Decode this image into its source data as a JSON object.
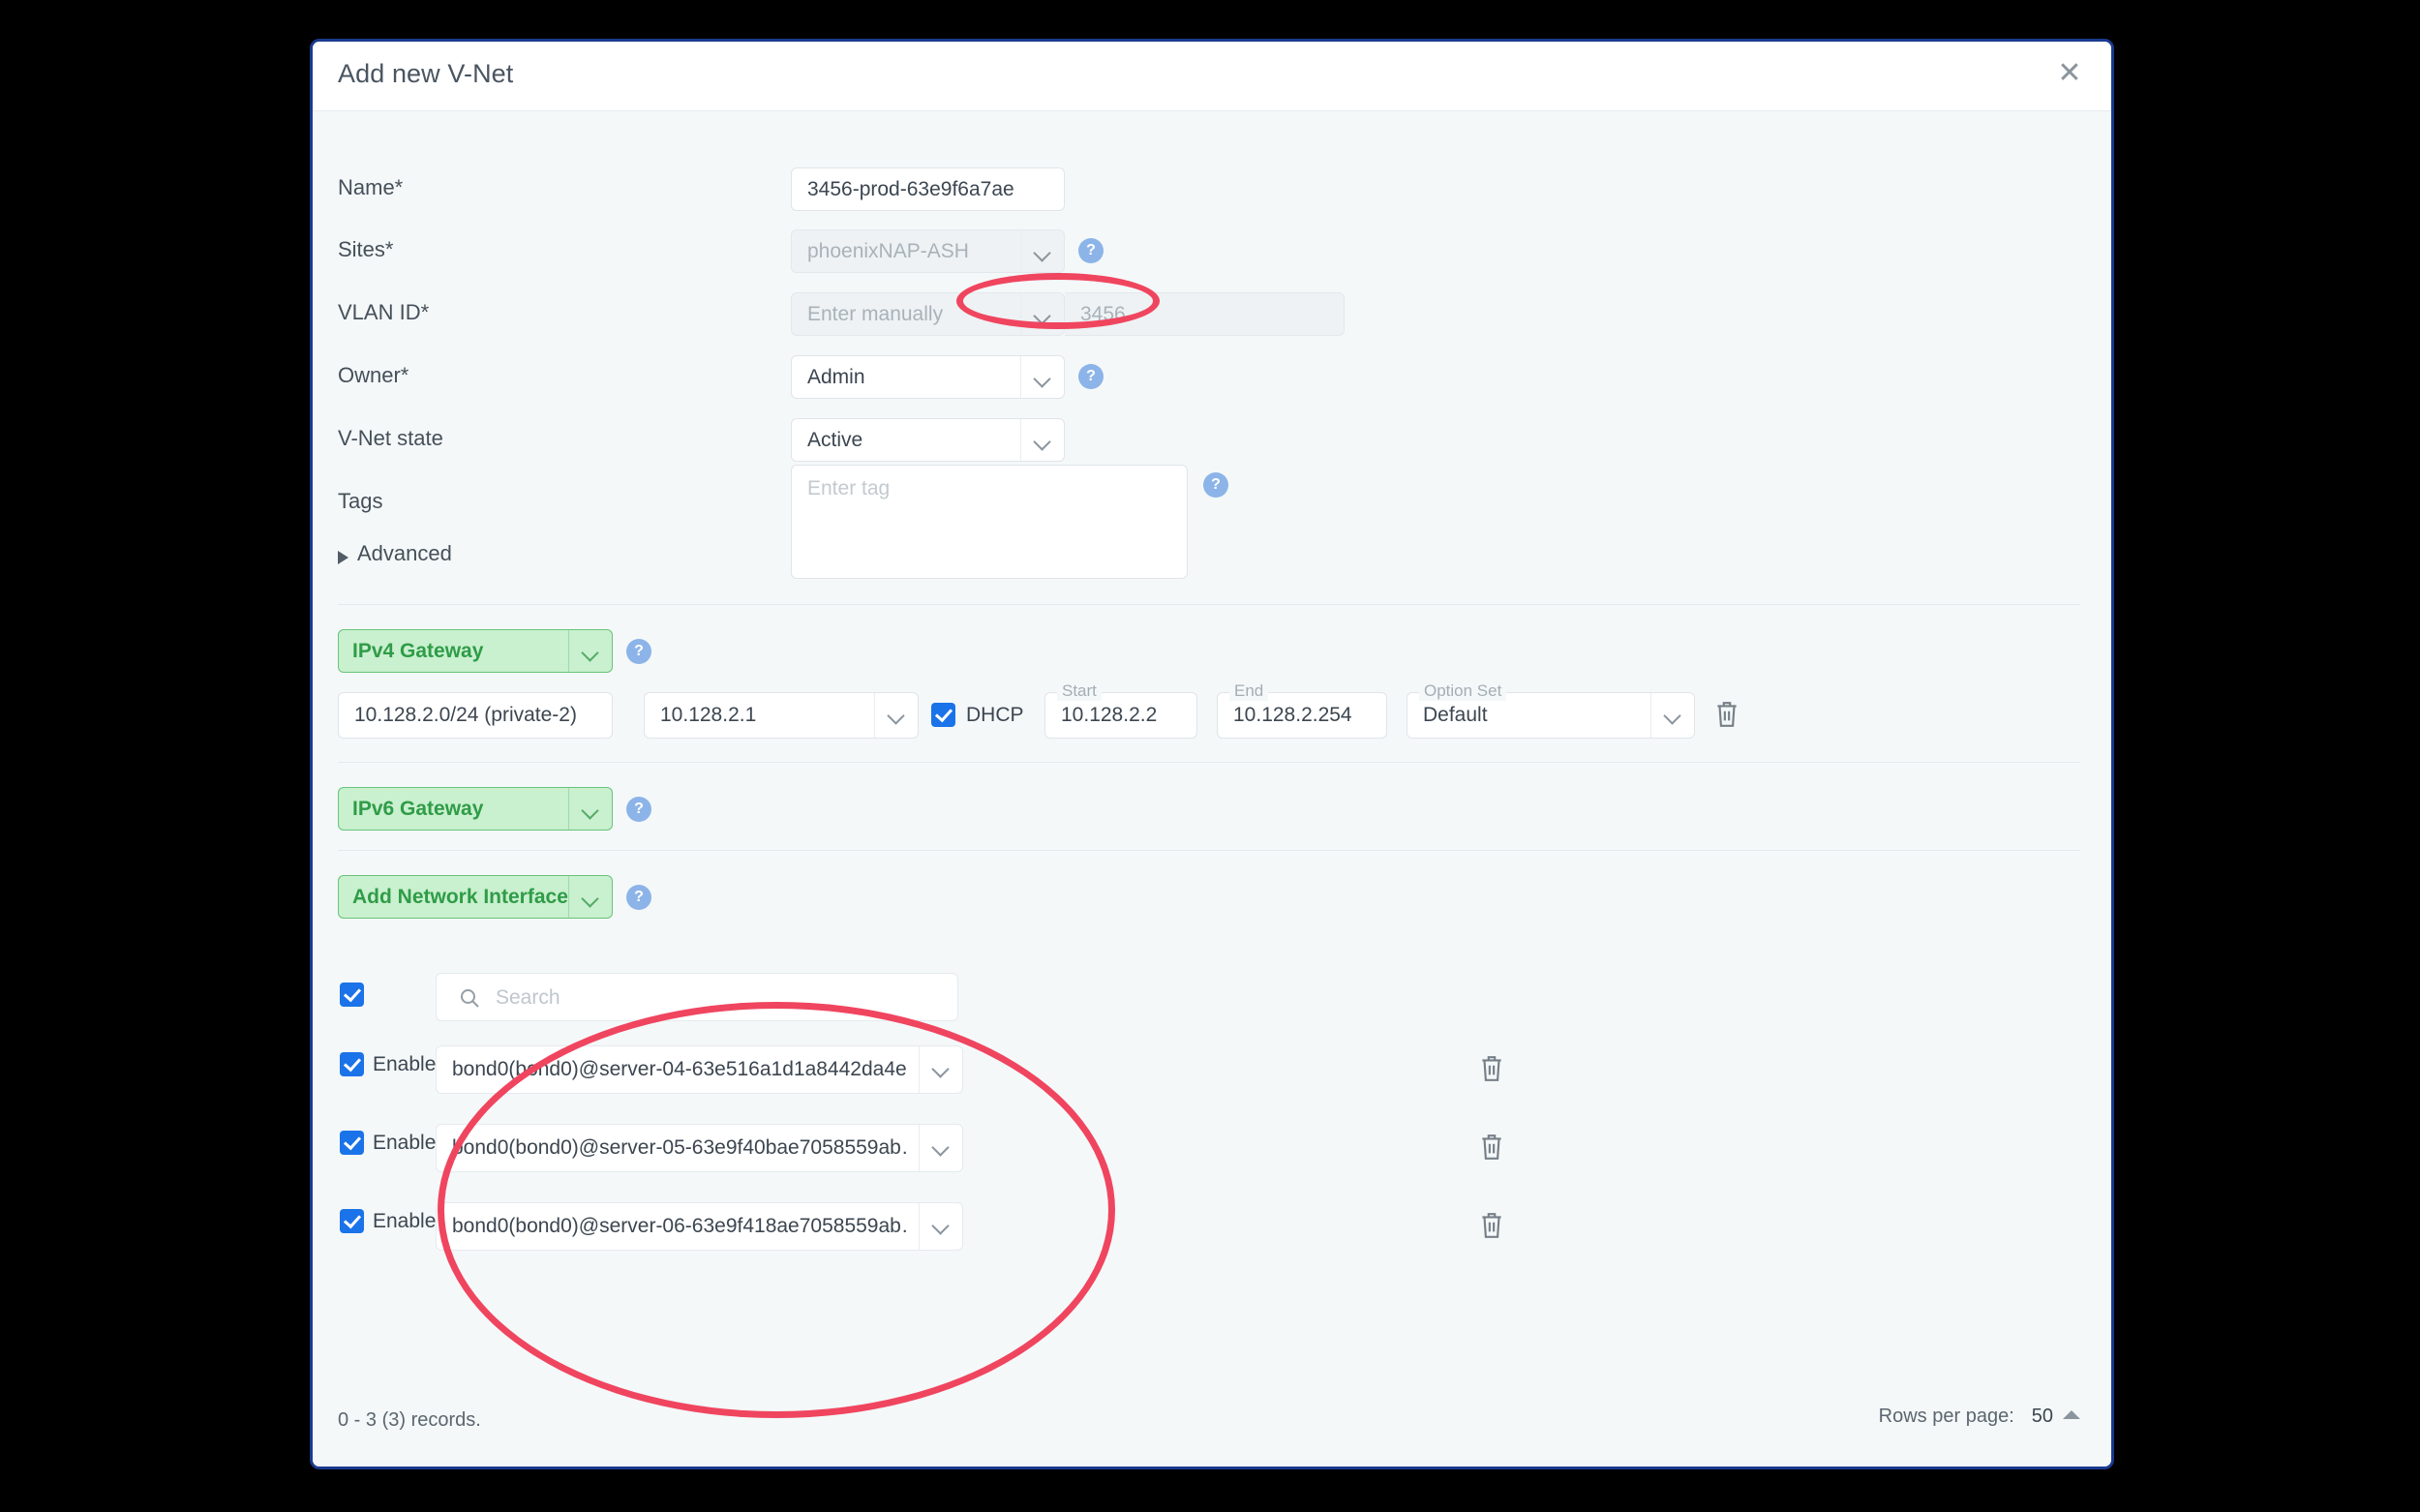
{
  "dialog": {
    "title": "Add new V-Net",
    "close_icon": "close-icon"
  },
  "form": {
    "name": {
      "label": "Name*",
      "value": "3456-prod-63e9f6a7ae"
    },
    "sites": {
      "label": "Sites*",
      "value": "phoenixNAP-ASH",
      "help": "?"
    },
    "vlan_id": {
      "label": "VLAN ID*",
      "mode_value": "Enter manually",
      "id_value": "3456"
    },
    "owner": {
      "label": "Owner*",
      "value": "Admin",
      "help": "?"
    },
    "vnet_state": {
      "label": "V-Net state",
      "value": "Active"
    },
    "tags": {
      "label": "Tags",
      "placeholder": "Enter tag",
      "help": "?"
    },
    "advanced": {
      "label": "Advanced"
    }
  },
  "gateways": {
    "ipv4": {
      "selector_label": "IPv4 Gateway",
      "help": "?",
      "network": "10.128.2.0/24 (private-2)",
      "gateway_ip": "10.128.2.1",
      "dhcp_label": "DHCP",
      "start": {
        "label": "Start",
        "value": "10.128.2.2"
      },
      "end": {
        "label": "End",
        "value": "10.128.2.254"
      },
      "option_set": {
        "label": "Option Set",
        "value": "Default"
      },
      "delete_icon": "trash-icon"
    },
    "ipv6": {
      "selector_label": "IPv6 Gateway",
      "help": "?"
    }
  },
  "network_interfaces": {
    "add_label": "Add Network Interface",
    "add_help": "?",
    "search_placeholder": "Search",
    "search_icon": "search-icon",
    "select_all_checked": true,
    "rows": [
      {
        "enabled_label": "Enabled",
        "checked": true,
        "value": "bond0(bond0)@server-04-63e516a1d1a8442da4e…"
      },
      {
        "enabled_label": "Enabled",
        "checked": true,
        "value": "bond0(bond0)@server-05-63e9f40bae7058559ab…"
      },
      {
        "enabled_label": "Enabled",
        "checked": true,
        "value": "bond0(bond0)@server-06-63e9f418ae7058559ab…"
      }
    ]
  },
  "footer": {
    "records": "0 - 3 (3) records.",
    "rows_per_page_label": "Rows per page:",
    "rows_per_page_value": "50"
  },
  "annotations": {
    "color": "#f0455f",
    "vlan_ellipse": "highlight around VLAN ID value 3456",
    "interfaces_ellipse": "highlight around network interface rows"
  }
}
